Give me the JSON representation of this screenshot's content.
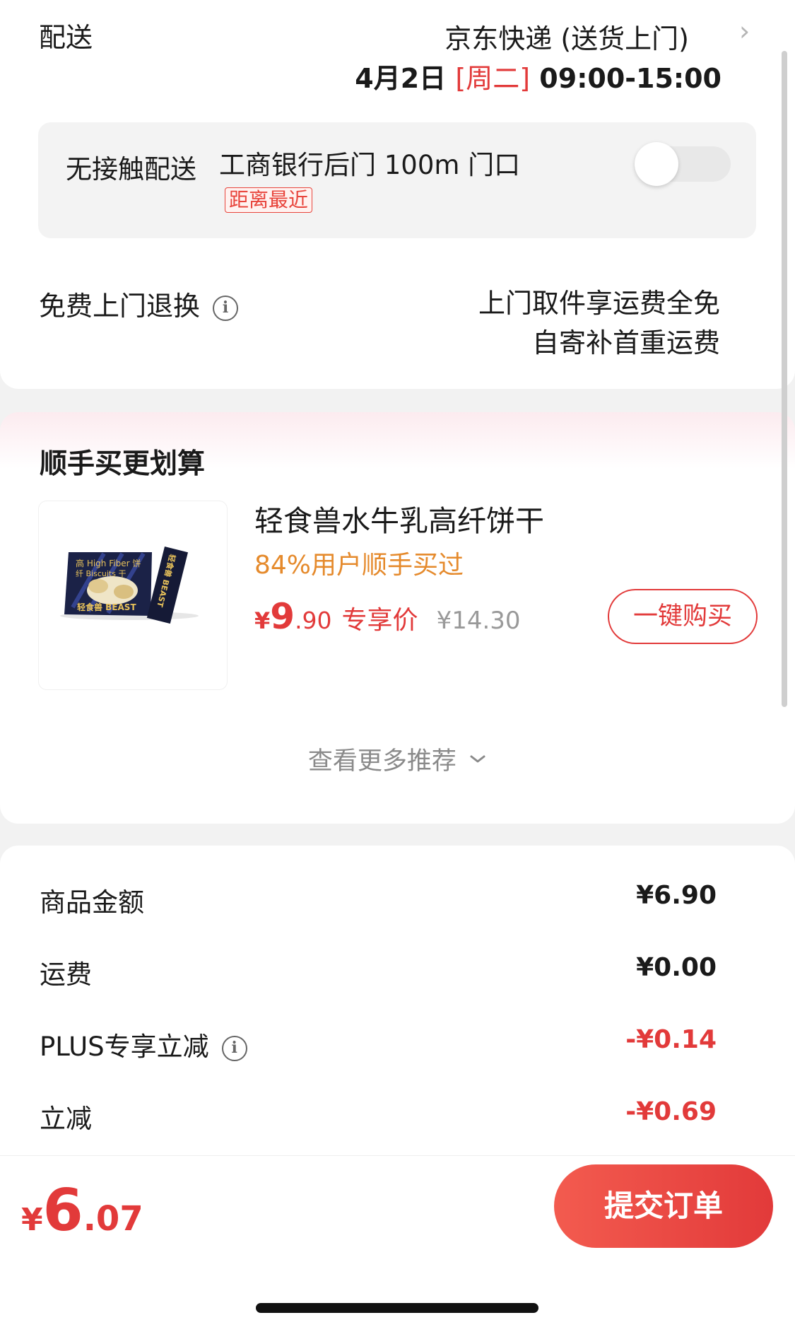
{
  "delivery": {
    "label": "配送",
    "method": "京东快递 (送货上门)",
    "date": "4月2日 ",
    "weekday": "[周二]",
    "time": " 09:00-15:00"
  },
  "contactless": {
    "label": "无接触配送",
    "address": "工商银行后门 100m 门口",
    "badge": "距离最近",
    "toggle_on": false
  },
  "free_return": {
    "label": "免费上门退换",
    "line1": "上门取件享运费全免",
    "line2": "自寄补首重运费"
  },
  "recommend": {
    "title": "顺手买更划算",
    "product": {
      "name": "轻食兽水牛乳高纤饼干",
      "promo": "84%用户顺手买过",
      "price_symbol": "¥",
      "price_int": "9",
      "price_dec": ".90",
      "price_tag": "专享价",
      "original_price": "¥14.30",
      "buy_label": "一键购买",
      "image_text": {
        "line1": "高 High Fiber 饼",
        "line2": "纤   Biscuits  干",
        "brand": "轻食兽 BEAST",
        "stick": "轻食兽 BEAST"
      }
    },
    "see_more": "查看更多推荐"
  },
  "summary": {
    "rows": [
      {
        "label": "商品金额",
        "value": "¥6.90",
        "negative": false,
        "info": false
      },
      {
        "label": "运费",
        "value": "¥0.00",
        "negative": false,
        "info": false
      },
      {
        "label": "PLUS专享立减",
        "value": "-¥0.14",
        "negative": true,
        "info": true
      },
      {
        "label": "立减",
        "value": "-¥0.69",
        "negative": true,
        "info": false
      }
    ]
  },
  "bottom": {
    "total_symbol": "¥",
    "total_int": "6",
    "total_dec": ".07",
    "submit_label": "提交订单"
  },
  "colors": {
    "accent_red": "#e23a3a",
    "promo_orange": "#e58a2c"
  }
}
